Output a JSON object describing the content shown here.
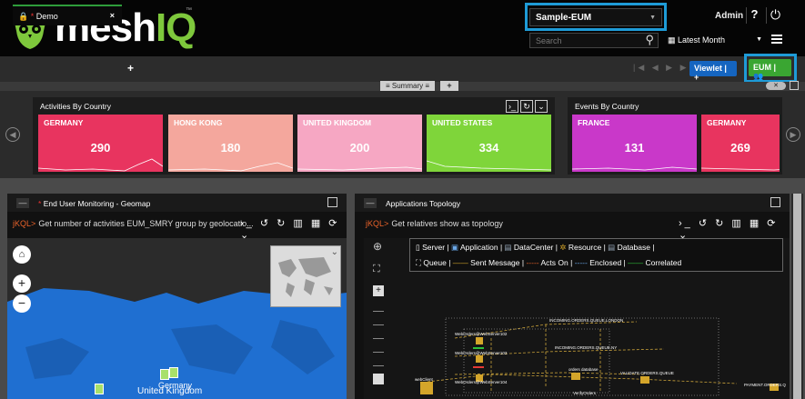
{
  "header": {
    "logo_main": "mesh",
    "logo_accent": "IQ",
    "logo_tm": "™",
    "environment_select": "Sample-EUM",
    "search_placeholder": "Search",
    "time_range": "Latest Month",
    "user": "Admin",
    "help": "?",
    "power": "⏻"
  },
  "tabs": {
    "active": {
      "label": "Demo",
      "modified_marker": "*",
      "close": "×"
    },
    "add": "+"
  },
  "toolbar": {
    "pager": "|◀ ◀ ▶ ▶|",
    "viewlet_label": "Viewlet",
    "viewlet_plus": "+",
    "eum_label": "EUM"
  },
  "summary_strip": {
    "label": "≡ Summary ≡",
    "add": "+",
    "toggle": "✕"
  },
  "summary_groups": [
    {
      "title": "Activities By Country",
      "cards": [
        {
          "name": "GERMANY",
          "value": "290",
          "color": "#e8345f"
        },
        {
          "name": "HONG KONG",
          "value": "180",
          "color": "#f4a79d"
        },
        {
          "name": "UNITED KINGDOM",
          "value": "200",
          "color": "#f6a7c3"
        },
        {
          "name": "UNITED STATES",
          "value": "334",
          "color": "#7fd53a"
        }
      ]
    },
    {
      "title": "Events By Country",
      "cards": [
        {
          "name": "FRANCE",
          "value": "131",
          "color": "#c938c9"
        },
        {
          "name": "GERMANY",
          "value": "269",
          "color": "#e8345f"
        }
      ]
    }
  ],
  "panels": {
    "left": {
      "marker": "*",
      "title": "End User Monitoring - Geomap",
      "query_prefix": "jKQL>",
      "query": "Get number of activities EUM_SMRY group by geolocatio...",
      "map_label_1": "United Kingdom",
      "map_label_2": "Germany"
    },
    "right": {
      "title": "Applications Topology",
      "query_prefix": "jKQL>",
      "query": "Get relatives show as topology",
      "legend_row1": [
        "Server",
        "Application",
        "DataCenter",
        "Resource",
        "Database"
      ],
      "legend_row2": [
        "Queue",
        "Sent Message",
        "Acts On",
        "Enclosed",
        "Correlated"
      ],
      "nodes": [
        "INCOMING.ORDERS.QUEUE.LONDON",
        "WebOrders@WebServer102",
        "INCOMING.ORDERS.QUEUE.NY",
        "WebOrders@WebServer103",
        "orders database",
        "VALIDATE.ORDERS.QUEUE",
        "PAYMENT.ORDERS.Q",
        "webClient",
        "WebOrders@WebServer104",
        "VerifyOrders"
      ]
    }
  },
  "colors": {
    "highlight": "#1e9bd7",
    "brand_green": "#7ec83c",
    "eum_green": "#3aa632",
    "viewlet_blue": "#1565c0",
    "map_water": "#2b2b2b",
    "map_land": "#1f6fd1",
    "jkql_orange": "#e8622a"
  }
}
